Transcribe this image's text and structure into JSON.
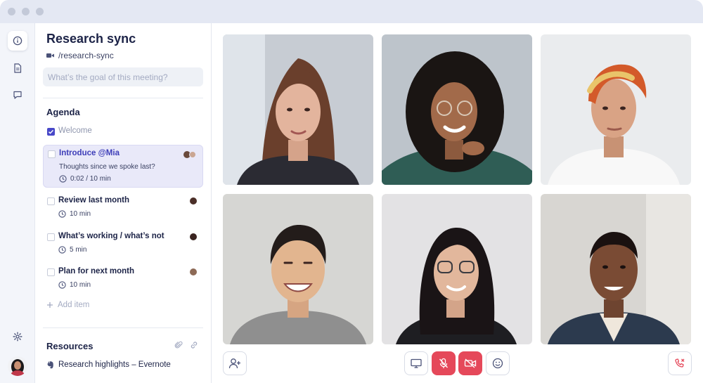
{
  "meeting": {
    "title": "Research sync",
    "room": "/research-sync",
    "goal_placeholder": "What’s the goal of this meeting?"
  },
  "agenda": {
    "heading": "Agenda",
    "items": [
      {
        "title": "Welcome",
        "checked": true
      },
      {
        "title": "Introduce @Mia",
        "note": "Thoughts since we spoke last?",
        "duration": "0:02 / 10 min",
        "active": true
      },
      {
        "title": "Review last month",
        "duration": "10 min"
      },
      {
        "title": "What’s working / what’s not",
        "duration": "5 min"
      },
      {
        "title": "Plan for next month",
        "duration": "10 min"
      }
    ],
    "add_label": "Add item"
  },
  "resources": {
    "heading": "Resources",
    "items": [
      {
        "title": "Research highlights – Evernote",
        "icon": "evernote-icon"
      }
    ]
  },
  "sidebar": {
    "icons": [
      "info-icon",
      "document-icon",
      "chat-icon",
      "gear-icon"
    ]
  },
  "controls": {
    "left": [
      "add-person-icon"
    ],
    "center": [
      "screen-share-icon",
      "mic-off-icon",
      "camera-off-icon",
      "emoji-icon"
    ],
    "right": [
      "hang-up-icon"
    ]
  },
  "colors": {
    "accent": "#4848c8",
    "danger": "#e5485a",
    "active_item_bg": "#e9e9f9",
    "titlebar": "#e4e8f3"
  },
  "participants": [
    "participant-1",
    "participant-2",
    "participant-3",
    "participant-4",
    "participant-5",
    "participant-6"
  ]
}
